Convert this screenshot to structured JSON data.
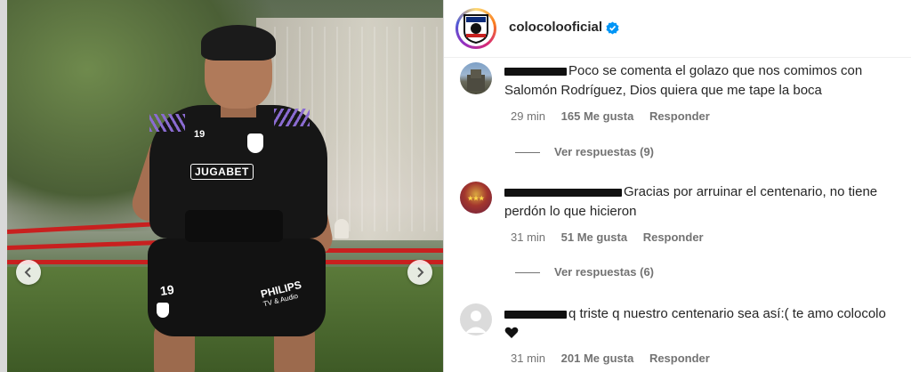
{
  "post": {
    "jersey_number": "19",
    "shorts_number": "19",
    "sponsor": "JUGABET",
    "shorts_brand": "PHILIPS",
    "shorts_brand_sub": "TV & Audio"
  },
  "header": {
    "username": "colocolooficial",
    "verified": true
  },
  "comments": [
    {
      "text": "Poco se comenta el golazo que nos comimos con Salomón Rodríguez, Dios quiera que me tape la boca",
      "time": "29 min",
      "likes": "165 Me gusta",
      "reply": "Responder",
      "view_replies": "Ver respuestas (9)"
    },
    {
      "text": "Gracias por arruinar el centenario, no tiene perdón lo que hicieron",
      "time": "31 min",
      "likes": "51 Me gusta",
      "reply": "Responder",
      "view_replies": "Ver respuestas (6)"
    },
    {
      "text": "q triste q nuestro centenario sea así:( te amo colocolo",
      "time": "31 min",
      "likes": "201 Me gusta",
      "reply": "Responder"
    }
  ],
  "colors": {
    "text": "#262626",
    "meta": "#737373",
    "verified": "#0095f6",
    "band": "#c8201f"
  },
  "icons": {
    "prev": "chevron-left-icon",
    "next": "chevron-right-icon",
    "verified": "verified-badge-icon",
    "heart": "black-heart-icon"
  }
}
